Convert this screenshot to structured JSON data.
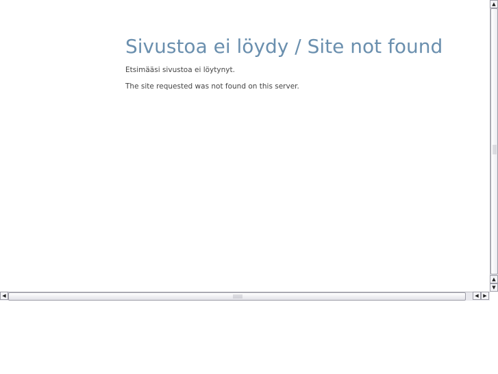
{
  "page": {
    "title": "Sivustoa ei löydy / Site not found",
    "message_fi": "Etsimääsi sivustoa ei löytynyt.",
    "message_en": "The site requested was not found on this server."
  },
  "colors": {
    "title": "#6a8fae",
    "text": "#444444",
    "background": "#ffffff",
    "scrollbar_track": "#e9e9ee"
  },
  "scrollbars": {
    "vertical": {
      "up_icon": "▲",
      "down_icon": "▼"
    },
    "horizontal": {
      "left_icon": "◀",
      "right_icon": "▶"
    }
  }
}
